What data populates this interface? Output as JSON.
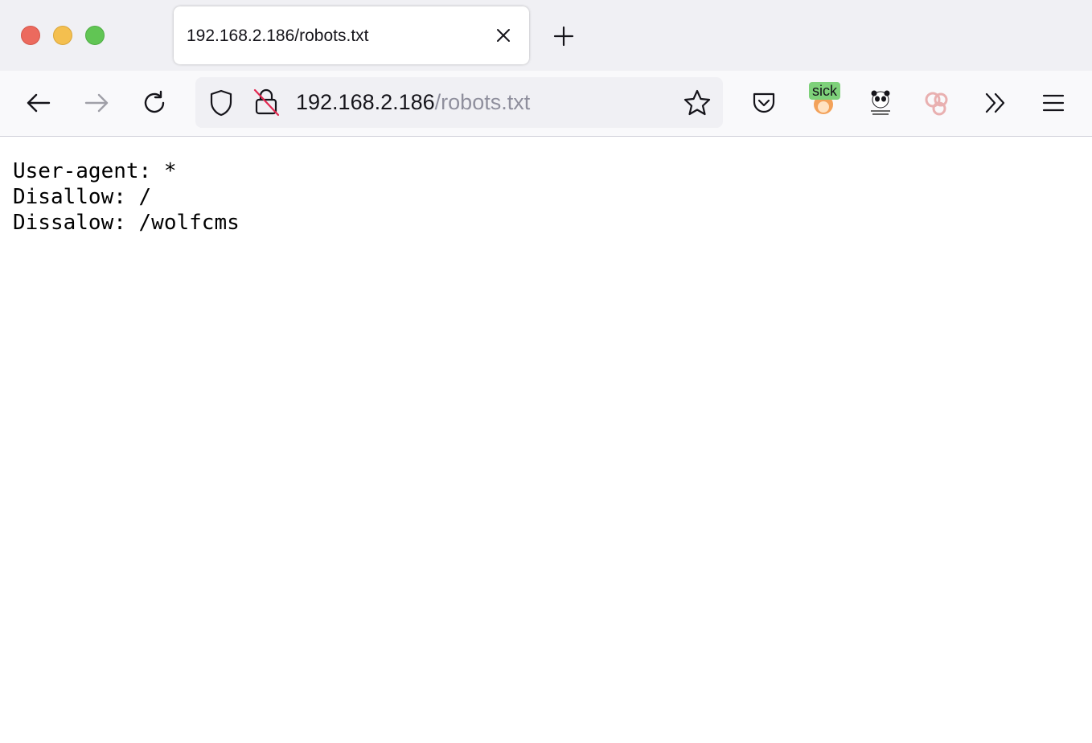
{
  "window": {
    "tab": {
      "title": "192.168.2.186/robots.txt"
    }
  },
  "navigation": {
    "url_host": "192.168.2.186",
    "url_path": "/robots.txt"
  },
  "toolbar": {
    "extension_badge": "sick"
  },
  "page": {
    "lines": [
      "User-agent: *",
      "Disallow: /",
      "Dissalow: /wolfcms"
    ]
  },
  "icons": {
    "close_window": "close-window-icon",
    "minimize_window": "minimize-window-icon",
    "maximize_window": "maximize-window-icon",
    "back": "back-arrow-icon",
    "forward": "forward-arrow-icon",
    "reload": "reload-icon",
    "shield": "tracking-protection-shield-icon",
    "insecure_lock": "insecure-lock-icon",
    "bookmark": "bookmark-star-icon",
    "pocket": "pocket-icon",
    "menu": "hamburger-menu-icon",
    "overflow": "overflow-chevrons-icon"
  },
  "colors": {
    "tabstrip_bg": "#f0f0f4",
    "navbar_bg": "#f9f9fb",
    "urlbar_bg": "#f0f0f4",
    "url_path_color": "#8f8f9d",
    "insecure_strike": "#e22850",
    "traffic_red": "#ec6a5e",
    "traffic_yellow": "#f4bf4f",
    "traffic_green": "#61c554"
  }
}
